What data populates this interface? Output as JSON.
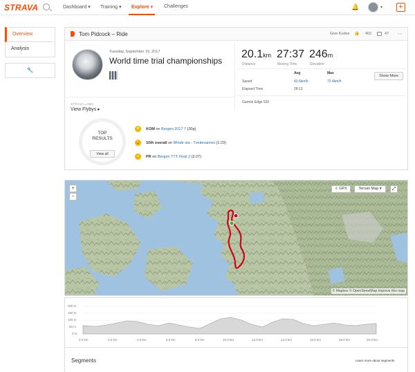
{
  "nav": {
    "logo": "STRAVA",
    "items": [
      {
        "label": "Dashboard ▾"
      },
      {
        "label": "Training ▾"
      },
      {
        "label": "Explore ▾"
      },
      {
        "label": "Challenges"
      }
    ],
    "accent": "#fc4c02"
  },
  "sidebar": {
    "items": [
      {
        "label": "Overview"
      },
      {
        "label": "Analysis"
      }
    ]
  },
  "activity": {
    "header_title": "Tom Pidcock – Ride",
    "give_kudos": "Give Kudos",
    "kudos_count": "402",
    "comment_count": "47",
    "date": "Tuesday, September 19, 2017",
    "name": "World time trial championships",
    "flyby_label": "STRAVA LABS",
    "flyby_link": "View Flybys ▸"
  },
  "stats": {
    "distance": {
      "value": "20.1",
      "unit": "km",
      "label": "Distance"
    },
    "moving_time": {
      "value": "27:37",
      "label": "Moving Time"
    },
    "elevation": {
      "value": "246",
      "unit": "m",
      "label": "Elevation"
    },
    "table": {
      "col_avg": "Avg",
      "col_max": "Max",
      "speed_label": "Speed",
      "speed_avg": "43.6km/h",
      "speed_max": "72.4km/h",
      "elapsed_label": "Elapsed Time",
      "elapsed_value": "28:13"
    },
    "show_more": "Show More",
    "device": "Garmin Edge 520"
  },
  "top_results": {
    "title_line1": "TOP",
    "title_line2": "RESULTS",
    "view_all": "View all",
    "items": [
      {
        "prefix": "KOM",
        "mid": " on ",
        "link": "Bergen 2017 7",
        "suffix": " (30p)"
      },
      {
        "prefix": "10th overall",
        "mid": " on ",
        "link": "Minde sta - Tveitevannet",
        "suffix": " (1:23)"
      },
      {
        "prefix": "PR",
        "mid": " on ",
        "link": "Bergen TTT Final 2",
        "suffix": " (2:27)"
      }
    ]
  },
  "map": {
    "zoom_in": "+",
    "zoom_out": "−",
    "gpx": "GPX",
    "terrain": "Terrain Map ▾",
    "attribution": "© Mapbox © OpenStreetMap Improve this map",
    "route_color": "#d0021b"
  },
  "elevation_chart": {
    "y_ticks": [
      "200 m",
      "150 m",
      "100 m",
      "50 m",
      "0 m"
    ],
    "x_ticks": [
      "0.0 km",
      "2.0 km",
      "4.0 km",
      "6.0 km",
      "8.0 km",
      "10.0 km",
      "12.0 km",
      "14.0 km",
      "16.0 km",
      "18.0 km",
      "20.0 km"
    ]
  },
  "segments": {
    "title": "Segments",
    "learn_more": "Learn more about segments"
  }
}
